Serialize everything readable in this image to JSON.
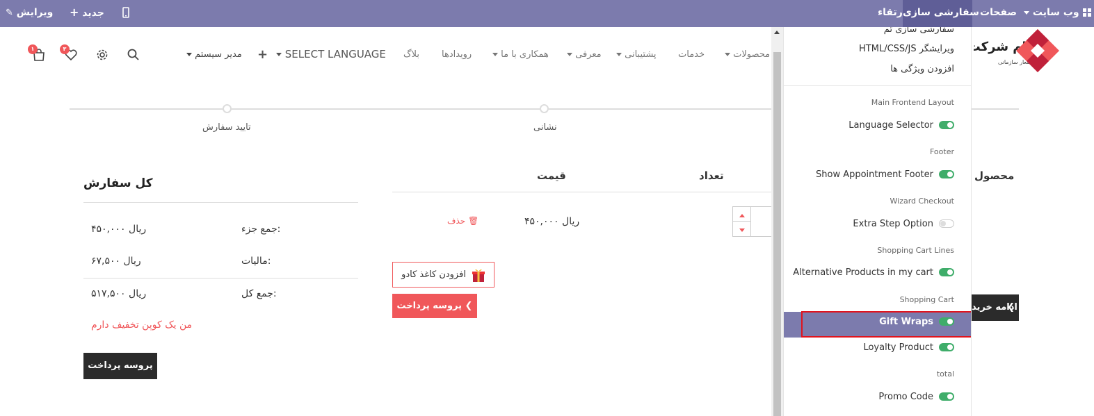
{
  "adminbar": {
    "edit": "ویرایش",
    "new": "جدید",
    "upgrade": "ارتقاء",
    "customize": "سفارشی سازی",
    "pages": "صفحات",
    "website": "وب سایت"
  },
  "header": {
    "brand_name": "نام شرکت",
    "brand_slogan": "شعار سازمانی",
    "nav": [
      "محصولات",
      "خدمات",
      "پشتیبانی",
      "معرفی",
      "همکاری با ما",
      "رویدادها",
      "بلاگ"
    ],
    "language": "SELECT LANGUAGE",
    "admin_menu": "مدیر سیستم",
    "cart_badge": "۱",
    "wishlist_badge": "۳"
  },
  "progress": {
    "steps": [
      "نشانی",
      "تایید سفارش"
    ]
  },
  "cart": {
    "columns": {
      "product": "محصول",
      "quantity": "تعداد",
      "price": "قیمت"
    },
    "row": {
      "price": "۴۵۰,۰۰۰ ریال",
      "remove": "حذف"
    },
    "gift_wrap": "افزودن کاغذ کادو",
    "checkout": "پروسه پرداخت"
  },
  "summary": {
    "title": "کل سفارش",
    "subtotal_label": "جمع جزء:",
    "subtotal_value": "۴۵۰,۰۰۰ ریال",
    "tax_label": "مالیات:",
    "tax_value": "۶۷,۵۰۰ ریال",
    "total_label": "جمع کل:",
    "total_value": "۵۱۷,۵۰۰ ریال",
    "coupon": "من یک کوپن تخفیف دارم",
    "checkout": "پروسه پرداخت"
  },
  "continue_button": "ادامه خرید",
  "dropdown": {
    "links": [
      "سفارشی سازی تم",
      "HTML/CSS/JS ویرایشگر",
      "افزودن ویژگی ها"
    ],
    "sections": [
      {
        "title": "Main Frontend Layout",
        "option": "Language Selector",
        "on": true
      },
      {
        "title": "Footer",
        "option": "Show Appointment Footer",
        "on": true
      },
      {
        "title": "Wizard Checkout",
        "option": "Extra Step Option",
        "on": false
      },
      {
        "title": "Shopping Cart Lines",
        "option": "Alternative Products in my cart",
        "on": true
      },
      {
        "title": "Shopping Cart",
        "option": "Gift Wraps",
        "on": true
      },
      {
        "title": "",
        "option": "Loyalty Product",
        "on": true
      },
      {
        "title": "total",
        "option": "Promo Code",
        "on": true
      }
    ]
  },
  "colors": {
    "adminbar": "#7c7bad",
    "accent_red": "#f0575a",
    "highlight": "#7c7bad",
    "highlight_border": "#e0141e",
    "toggle_on": "#3fad6a"
  }
}
